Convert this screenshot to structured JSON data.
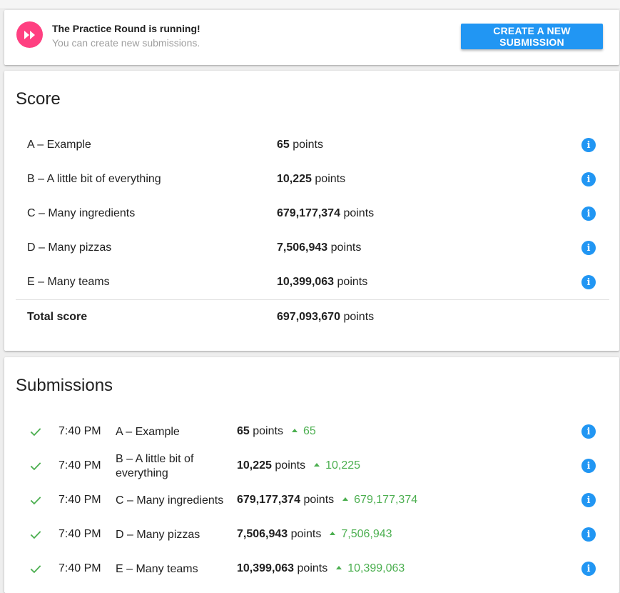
{
  "banner": {
    "title": "The Practice Round is running!",
    "subtitle": "You can create new submissions.",
    "create_button": "CREATE A NEW SUBMISSION",
    "icon": "fast-forward-icon"
  },
  "score": {
    "title": "Score",
    "rows": [
      {
        "task": "A – Example",
        "points": "65",
        "unit": "points"
      },
      {
        "task": "B – A little bit of everything",
        "points": "10,225",
        "unit": "points"
      },
      {
        "task": "C – Many ingredients",
        "points": "679,177,374",
        "unit": "points"
      },
      {
        "task": "D – Many pizzas",
        "points": "7,506,943",
        "unit": "points"
      },
      {
        "task": "E – Many teams",
        "points": "10,399,063",
        "unit": "points"
      }
    ],
    "total": {
      "label": "Total score",
      "points": "697,093,670",
      "unit": "points"
    }
  },
  "submissions": {
    "title": "Submissions",
    "rows": [
      {
        "time": "7:40 PM",
        "task": "A – Example",
        "points": "65",
        "unit": "points",
        "delta": "65"
      },
      {
        "time": "7:40 PM",
        "task": "B – A little bit of everything",
        "points": "10,225",
        "unit": "points",
        "delta": "10,225"
      },
      {
        "time": "7:40 PM",
        "task": "C – Many ingredients",
        "points": "679,177,374",
        "unit": "points",
        "delta": "679,177,374"
      },
      {
        "time": "7:40 PM",
        "task": "D – Many pizzas",
        "points": "7,506,943",
        "unit": "points",
        "delta": "7,506,943"
      },
      {
        "time": "7:40 PM",
        "task": "E – Many teams",
        "points": "10,399,063",
        "unit": "points",
        "delta": "10,399,063"
      }
    ]
  },
  "colors": {
    "accent_blue": "#2196f3",
    "round_pink": "#ff4081",
    "success_green": "#4caf50",
    "muted_text": "#9e9e9e"
  }
}
